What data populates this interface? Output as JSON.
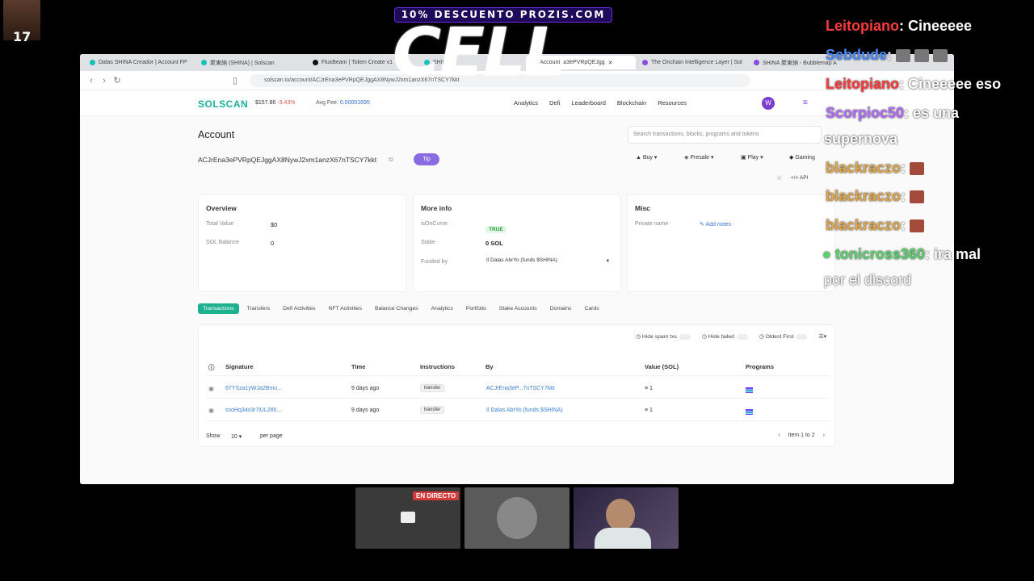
{
  "overlay": {
    "promo": "10% DESCUENTO PROZIS.COM",
    "logo": "CELL",
    "corner_badge": "17"
  },
  "browser": {
    "tabs": [
      {
        "label": "Dalas SHINA Creador | Account FP"
      },
      {
        "label": "聚東納 (SHINA) | Solscan"
      },
      {
        "label": "FluxBeam | Token Create v1"
      },
      {
        "label": "SHIN"
      },
      {
        "label": "Account"
      },
      {
        "label": "a3ePVRpQEJgg"
      },
      {
        "label": "The Onchain Intelligence Layer | Sol"
      },
      {
        "label": "SHINA 聚東納 - Bubblemap A"
      }
    ],
    "url": "solscan.io/account/ACJrEna3ePVRpQEJggAX8NywJ2xm1anzX67nTSCY7kkt"
  },
  "solscan": {
    "logo": "SOLSCAN",
    "sol_price": "$157.86",
    "sol_change": "-3.43%",
    "avg_fee_label": "Avg Fee:",
    "avg_fee": "0.00001695",
    "nav": [
      "Analytics",
      "Defi",
      "Leaderboard",
      "Blockchain",
      "Resources"
    ],
    "user_initial": "W",
    "search_placeholder": "Search transactions, blocks, programs and tokens",
    "page_title": "Account",
    "address": "ACJrEna3ePVRpQEJggAX8NywJ2xm1anzX67nTSCY7kkt",
    "tip": "Tip",
    "actions": [
      "Buy",
      "Presale",
      "Play",
      "Gaming"
    ],
    "api": "API",
    "overview": {
      "title": "Overview",
      "total_value_label": "Total Value",
      "total_value": "$0",
      "sol_balance_label": "SOL Balance",
      "sol_balance": "0"
    },
    "more_info": {
      "title": "More info",
      "oncurve_label": "isOnCurve",
      "oncurve": "TRUE",
      "stake_label": "Stake",
      "stake": "0 SOL",
      "funded_label": "Funded by",
      "funded": "Il Dalas AbrYo (funds $SHINA)"
    },
    "misc": {
      "title": "Misc",
      "private_name_label": "Private name",
      "add_notes": "Add notes"
    },
    "page_tabs": [
      "Transactions",
      "Transfers",
      "Defi Activities",
      "NFT Activities",
      "Balance Changes",
      "Analytics",
      "Portfolio",
      "Stake Accounts",
      "Domains",
      "Cards"
    ],
    "filters": [
      "Hide spam txs",
      "Hide failed",
      "Oldest First"
    ],
    "columns": [
      "Signature",
      "Time",
      "Instructions",
      "By",
      "Value (SOL)",
      "Programs"
    ],
    "rows": [
      {
        "sig": "67YSza1yWJa2Bmu...",
        "time": "9 days ago",
        "instr": "transfer",
        "by": "ACJrEna3eP...7nTSCY7kkt",
        "value": "1"
      },
      {
        "sig": "ssoHq34x3r7iUL285...",
        "time": "9 days ago",
        "instr": "transfer",
        "by": "Il Dalas AbrYo (funds $SHINA)",
        "value": "1"
      }
    ],
    "show_label": "Show",
    "per_page_value": "10",
    "per_page_label": "per page",
    "pager": "Item 1 to 2"
  },
  "chat": [
    {
      "user": "Leitopiano",
      "color": "#ff3a3a",
      "msg": ": Cineeeee"
    },
    {
      "user": "Sebdude",
      "color": "#4a8cff",
      "msg": ":"
    },
    {
      "user": "Leitopiano",
      "color": "#ff3a3a",
      "msg": ": Cineeeee eso"
    },
    {
      "user": "Scorpioc50",
      "color": "#b36bff",
      "msg": ": es una"
    },
    {
      "user": "",
      "color": "#ffffff",
      "msg": "supernova"
    },
    {
      "user": "blackraczo",
      "color": "#e0a64a",
      "msg": ":"
    },
    {
      "user": "blackraczo",
      "color": "#e0a64a",
      "msg": ":"
    },
    {
      "user": "blackraczo",
      "color": "#e0a64a",
      "msg": ":"
    },
    {
      "user": "tonicross360",
      "color": "#57d36a",
      "msg": ": ira mal"
    },
    {
      "user": "",
      "color": "#ffffff",
      "msg": "por el discord"
    }
  ],
  "live_badge": "EN DIRECTO"
}
